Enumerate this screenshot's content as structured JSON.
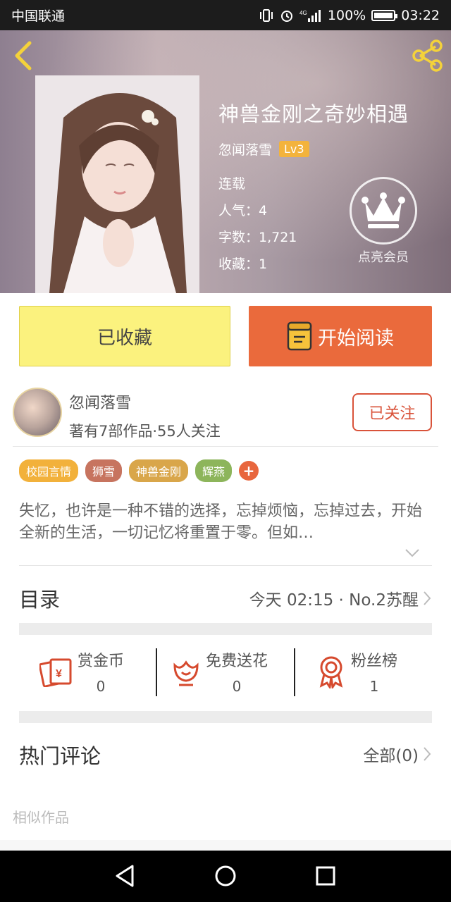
{
  "status_bar": {
    "carrier": "中国联通",
    "battery": "100%",
    "time": "03:22"
  },
  "book": {
    "title": "神兽金刚之奇妙相遇",
    "author": "忽闻落雪",
    "level": "Lv3",
    "status": "连载",
    "popularity": "人气：4",
    "word_count": "字数：1,721",
    "favorites": "收藏：1",
    "vip_label": "点亮会员"
  },
  "actions": {
    "collected": "已收藏",
    "read": "开始阅读"
  },
  "writer": {
    "name": "忽闻落雪",
    "stats": "著有7部作品·55人关注",
    "follow": "已关注"
  },
  "tags": [
    {
      "label": "校园言情",
      "color": "#f2b13b"
    },
    {
      "label": "狮雪",
      "color": "#c7745f"
    },
    {
      "label": "神兽金刚",
      "color": "#d9a64a"
    },
    {
      "label": "辉燕",
      "color": "#8db55b"
    }
  ],
  "tag_add": "+",
  "description": "失忆，也许是一种不错的选择，忘掉烦恼，忘掉过去，开始全新的生活，一切记忆将重置于零。但如…",
  "catalog": {
    "title": "目录",
    "latest": "今天 02:15 · No.2苏醒"
  },
  "stats": {
    "reward": {
      "label": "赏金币",
      "value": "0"
    },
    "flowers": {
      "label": "免费送花",
      "value": "0"
    },
    "fans": {
      "label": "粉丝榜",
      "value": "1"
    }
  },
  "comments": {
    "title": "热门评论",
    "all": "全部(0)"
  },
  "similar": "相似作品",
  "colors": {
    "accent_orange": "#ea6a3c",
    "accent_yellow": "#fbf27e",
    "icon_red": "#d64a2e"
  }
}
